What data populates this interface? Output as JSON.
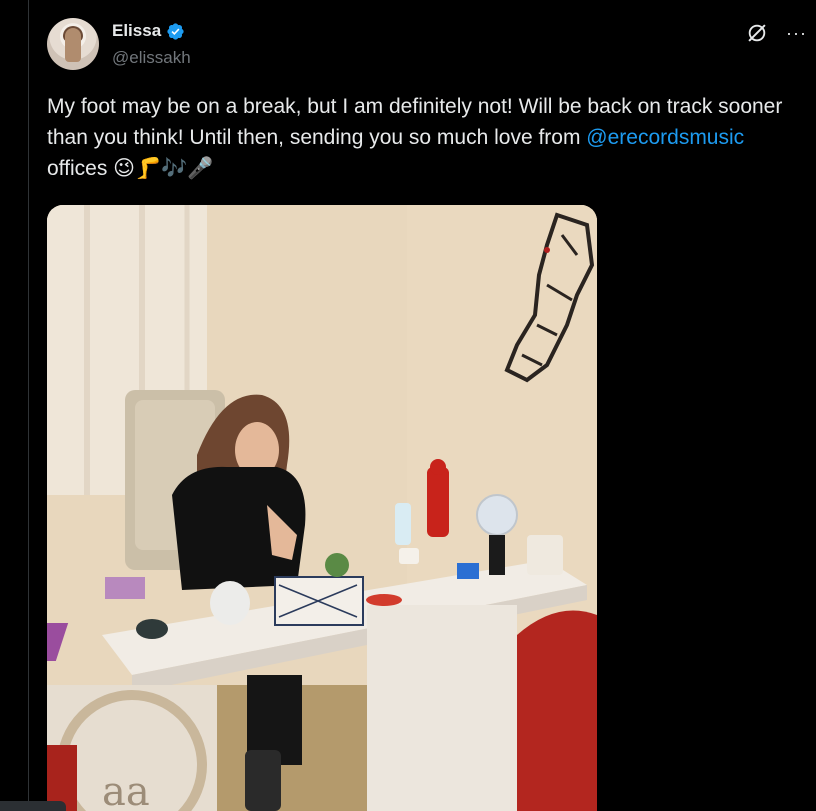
{
  "author": {
    "display_name": "Elissa",
    "handle": "@elissakh",
    "verified": true,
    "avatar_icon": "avatar-photo"
  },
  "header_actions": {
    "grok_icon": "grok-icon",
    "more_icon": "more-options-icon",
    "more_label": "···"
  },
  "tweet": {
    "text_before_mention": "My foot may be on a break, but I am definitely not! Will be back on track sooner than you think! Until then, sending you so much love from ",
    "mention": "@erecordsmusic",
    "text_after_mention": " offices ",
    "emoji": "😉🦵🎶🎤"
  },
  "media": {
    "type": "photo",
    "wall_logo_text": "aa"
  },
  "colors": {
    "background": "#000000",
    "text": "#e7e9ea",
    "muted": "#71767b",
    "accent": "#1d9bf0"
  }
}
